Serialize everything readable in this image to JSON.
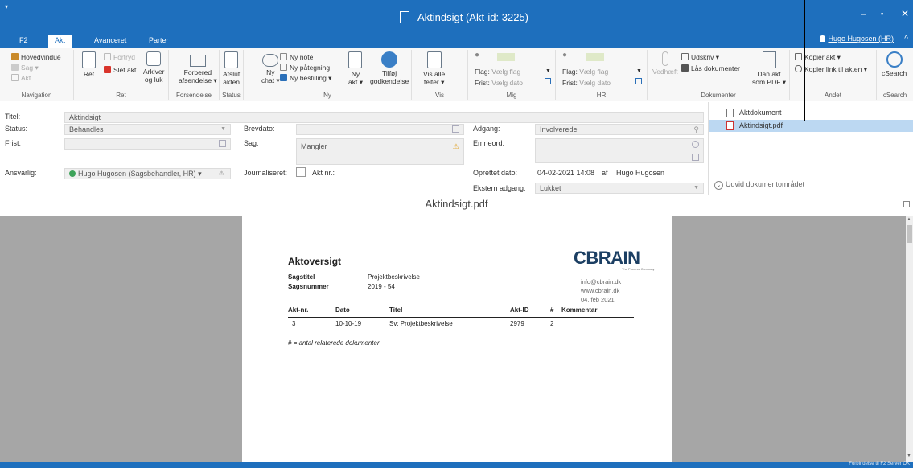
{
  "window": {
    "title": "Aktindsigt (Akt-id: 3225)",
    "sysmenu": "▾",
    "controls": [
      "–",
      "▪",
      "✕"
    ]
  },
  "tabs": [
    "F2",
    "Akt",
    "Avanceret",
    "Parter"
  ],
  "user": "Hugo Hugosen (HR)",
  "collapse": "^",
  "ribbon": {
    "navigation": {
      "label": "Navigation",
      "hovedvindue": "Hovedvindue",
      "sag": "Sag ▾",
      "akt": "Akt"
    },
    "ret": {
      "label": "Ret",
      "ret": "Ret",
      "fortryd": "Fortryd",
      "slet_akt": "Slet akt",
      "arkiver_1": "Arkiver",
      "arkiver_2": "og luk"
    },
    "forsendelse": {
      "label": "Forsendelse",
      "line1": "Forbered",
      "line2": "afsendelse ▾"
    },
    "status": {
      "label": "Status",
      "line1": "Afslut",
      "line2": "akten"
    },
    "ny": {
      "label": "Ny",
      "ny_chat_1": "Ny",
      "ny_chat_2": "chat ▾",
      "ny_note": "Ny note",
      "ny_paategning": "Ny påtegning",
      "ny_bestilling": "Ny bestilling ▾",
      "ny_akt_1": "Ny",
      "ny_akt_2": "akt ▾",
      "tilfoej_1": "Tilføj",
      "tilfoej_2": "godkendelse"
    },
    "vis": {
      "label": "Vis",
      "line1": "Vis alle",
      "line2": "felter ▾"
    },
    "mig": {
      "label": "Mig",
      "flag_label": "Flag:",
      "flag_value": "Vælg flag",
      "frist_label": "Frist:",
      "frist_value": "Vælg dato"
    },
    "hr": {
      "label": "HR",
      "flag_label": "Flag:",
      "flag_value": "Vælg flag",
      "frist_label": "Frist:",
      "frist_value": "Vælg dato"
    },
    "dokumenter": {
      "label": "Dokumenter",
      "vedhaeft": "Vedhæft",
      "udskriv": "Udskriv ▾",
      "laas": "Lås dokumenter",
      "dan_1": "Dan akt",
      "dan_2": "som PDF ▾"
    },
    "andet": {
      "label": "Andet",
      "kopier_akt": "Kopier akt ▾",
      "kopier_link": "Kopier link til akten ▾"
    },
    "csearch": {
      "label": "cSearch",
      "button": "cSearch"
    }
  },
  "form": {
    "titel_label": "Titel:",
    "titel_value": "Aktindsigt",
    "status_label": "Status:",
    "status_value": "Behandles",
    "frist_label": "Frist:",
    "ansvarlig_label": "Ansvarlig:",
    "ansvarlig_value": "Hugo Hugosen (Sagsbehandler, HR) ▾",
    "brevdato_label": "Brevdato:",
    "sag_label": "Sag:",
    "sag_value": "Mangler",
    "journaliseret_label": "Journaliseret:",
    "aktnr_label": "Akt nr.:",
    "adgang_label": "Adgang:",
    "adgang_value": "Involverede",
    "emneord_label": "Emneord:",
    "oprettet_label": "Oprettet dato:",
    "oprettet_date": "04-02-2021 14:08",
    "oprettet_af": "af",
    "oprettet_by": "Hugo Hugosen",
    "ekstern_label": "Ekstern adgang:",
    "ekstern_value": "Lukket"
  },
  "documents": {
    "items": [
      "Aktdokument",
      "Aktindsigt.pdf"
    ],
    "expand_label": "Udvid dokumentområdet"
  },
  "preview": {
    "filename": "Aktindsigt.pdf",
    "page": {
      "heading": "Aktoversigt",
      "sagstitel_label": "Sagstitel",
      "sagstitel_value": "Projektbeskrivelse",
      "sagsnummer_label": "Sagsnummer",
      "sagsnummer_value": "2019 - 54",
      "logo": "CBRAIN",
      "logo_sub": "The Process Company",
      "email": "info@cbrain.dk",
      "web": "www.cbrain.dk",
      "date": "04. feb 2021",
      "table": {
        "headers": [
          "Akt-nr.",
          "Dato",
          "Titel",
          "Akt-ID",
          "#",
          "Kommentar"
        ],
        "rows": [
          [
            "3",
            "10-10-19",
            "Sv: Projektbeskrivelse",
            "2979",
            "2",
            ""
          ]
        ]
      },
      "footnote": "# = antal relaterede dokumenter"
    }
  },
  "statusbar": "Forbindelse til F2 Server OK"
}
